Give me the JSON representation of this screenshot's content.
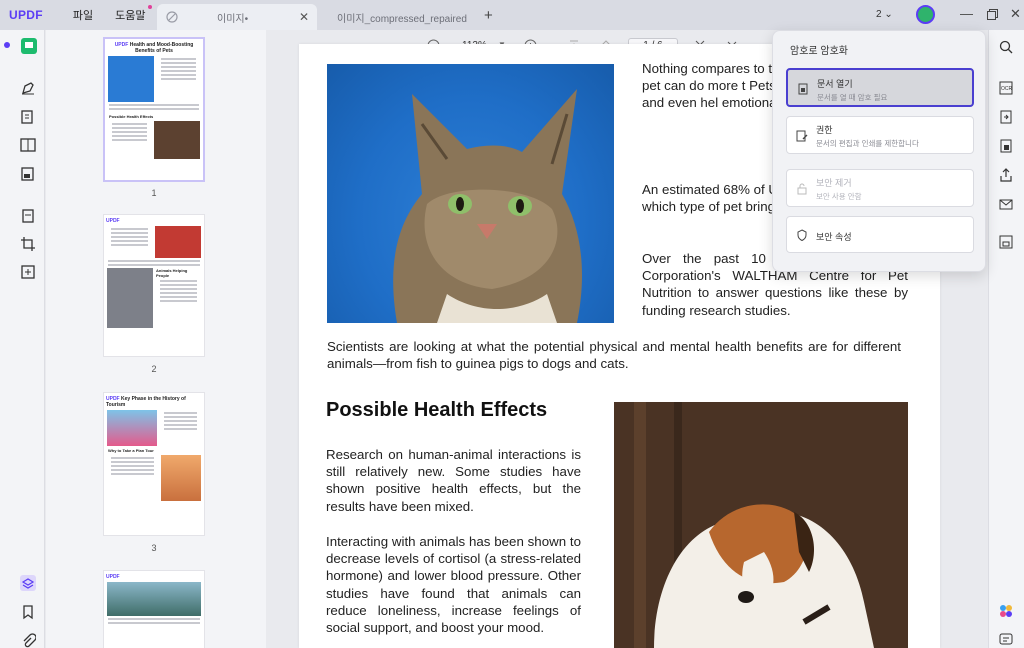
{
  "app": {
    "logo": "UPDF"
  },
  "menu": {
    "file": "파일",
    "help": "도움말"
  },
  "tabs": [
    {
      "label": "이미지•",
      "active": true
    },
    {
      "label": "이미지_compressed_repaired",
      "active": false
    }
  ],
  "titlebar": {
    "new_tab": "+",
    "window_count": "2",
    "window_count_caret": "⌄"
  },
  "toolbar": {
    "zoom": "112%",
    "page_current": "1",
    "page_total": "6",
    "page_sep": "/"
  },
  "thumbnails": {
    "pages": [
      {
        "num": "1",
        "logo": "UPDF",
        "title": "Health and Mood-Boosting Benefits of Pets",
        "section": "Possible Health Effects"
      },
      {
        "num": "2",
        "logo": "UPDF",
        "section": "Animals Helping People"
      },
      {
        "num": "3",
        "logo": "UPDF",
        "title": "Key Phase in the History of Tourism",
        "section": "Why to Take a Plan Tour"
      },
      {
        "num": "",
        "logo": "UPDF"
      }
    ]
  },
  "document": {
    "right_paragraphs": [
      "Nothing compares to t to a loyal companion. of a pet can do more t Pets may also decreas health, and even hel emotional and social s",
      "An estimated 68% of U pet. But who benefits which type of pet brings",
      "Over the past 10 yea with the Mars Corporation's WALTHAM Centre for Pet Nutrition to answer questions like these by funding research studies."
    ],
    "full_paragraph": "Scientists are looking at what the potential physical and mental health benefits are for different animals—from fish to guinea pigs to dogs and cats.",
    "heading": "Possible Health Effects",
    "left_paragraphs": [
      "Research on human-animal interactions is still relatively new. Some studies have shown positive health effects, but the results have been mixed.",
      "Interacting with animals has been shown to decrease levels of cortisol (a stress-related hormone) and lower blood pressure. Other studies have found that animals can reduce loneliness, increase feelings of social support, and boost your mood."
    ]
  },
  "security_popup": {
    "title": "암호로 암호화",
    "cards": [
      {
        "title": "문서 열기",
        "subtitle": "문서를 열 때 암호 필요",
        "icon": "document-lock-icon",
        "state": "highlighted"
      },
      {
        "title": "권한",
        "subtitle": "문서의 편집과 인쇄를 제한합니다",
        "icon": "edit-lock-icon",
        "state": "normal"
      },
      {
        "title": "보안 제거",
        "subtitle": "보안 사용 안함",
        "icon": "unlock-icon",
        "state": "disabled"
      },
      {
        "title": "보안 속성",
        "subtitle": "",
        "icon": "shield-icon",
        "state": "normal"
      }
    ]
  },
  "colors": {
    "accent": "#5b3df5",
    "highlight_border": "#4a3fd0",
    "avatar": "#2fb36c"
  }
}
